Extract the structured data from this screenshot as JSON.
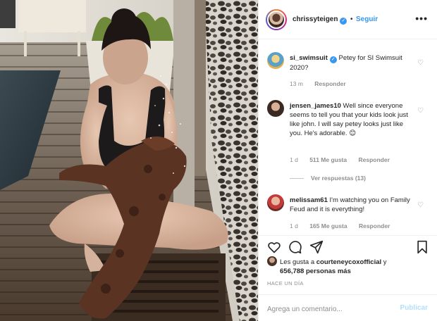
{
  "header": {
    "username": "chrissyteigen",
    "separator": "•",
    "follow_label": "Seguir",
    "more_label": "•••"
  },
  "comments": [
    {
      "username": "si_swimsuit",
      "verified": true,
      "text": "Petey for SI Swimsuit 2020?",
      "time": "13 m",
      "reply_label": "Responder"
    },
    {
      "username": "jensen_james10",
      "text": "Well since everyone seems to tell you that your kids look just like john. I will say petey looks just like you. He's adorable. 😊",
      "time": "1 d",
      "likes": "511 Me gusta",
      "reply_label": "Responder",
      "view_replies": "Ver respuestas (13)"
    },
    {
      "username": "melissam61",
      "text": "I'm watching you on Family Feud and it is everything!",
      "time": "1 d",
      "likes": "165 Me gusta",
      "reply_label": "Responder"
    }
  ],
  "likes": {
    "prefix": "Les gusta a",
    "first_user": "courteneycoxofficial",
    "connector": "y",
    "count": "656,788 personas más"
  },
  "timestamp": "HACE UN DÍA",
  "add_comment": {
    "placeholder": "Agrega un comentario...",
    "post_label": "Publicar"
  },
  "colors": {
    "accent": "#3897f0",
    "post_disabled": "#b2dffc",
    "muted": "#8e8e8e",
    "text": "#262626"
  },
  "icons": [
    "verified-badge-icon",
    "more-options-icon",
    "heart-icon",
    "comment-icon",
    "share-icon",
    "bookmark-icon"
  ]
}
